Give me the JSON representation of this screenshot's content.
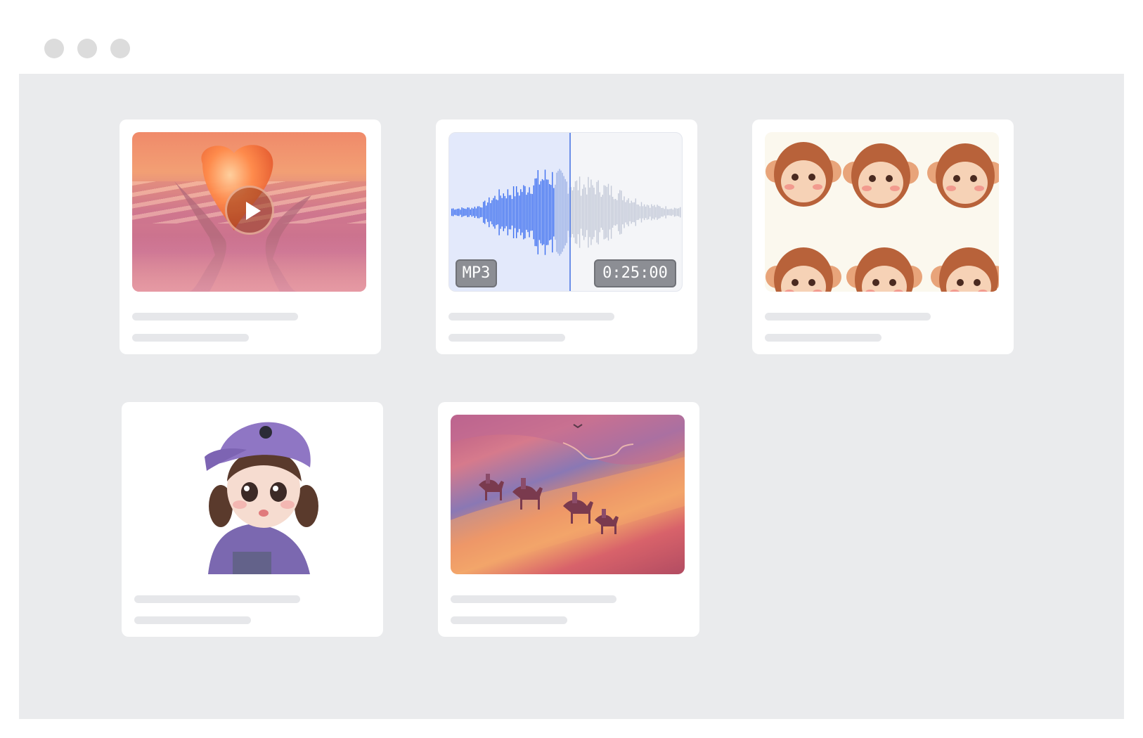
{
  "window": {
    "controls": [
      "window-control-1",
      "window-control-2",
      "window-control-3"
    ]
  },
  "cards": [
    {
      "id": "video",
      "kind": "video-thumbnail",
      "icon": "play-icon"
    },
    {
      "id": "audio",
      "kind": "audio-waveform",
      "format_label": "MP3",
      "duration_label": "0:25:00",
      "played_fraction": 0.51
    },
    {
      "id": "stickers",
      "kind": "image"
    },
    {
      "id": "avatar",
      "kind": "image"
    },
    {
      "id": "desert",
      "kind": "image"
    }
  ],
  "colors": {
    "canvas": "#eaebed",
    "card": "#ffffff",
    "placeholder_line": "#e6e7ea",
    "waveform_played": "#3d6ff0",
    "waveform_played_highlight": "#9fb3e6",
    "waveform_unplayed": "#c3c9d8",
    "badge": "#8c8e94"
  }
}
